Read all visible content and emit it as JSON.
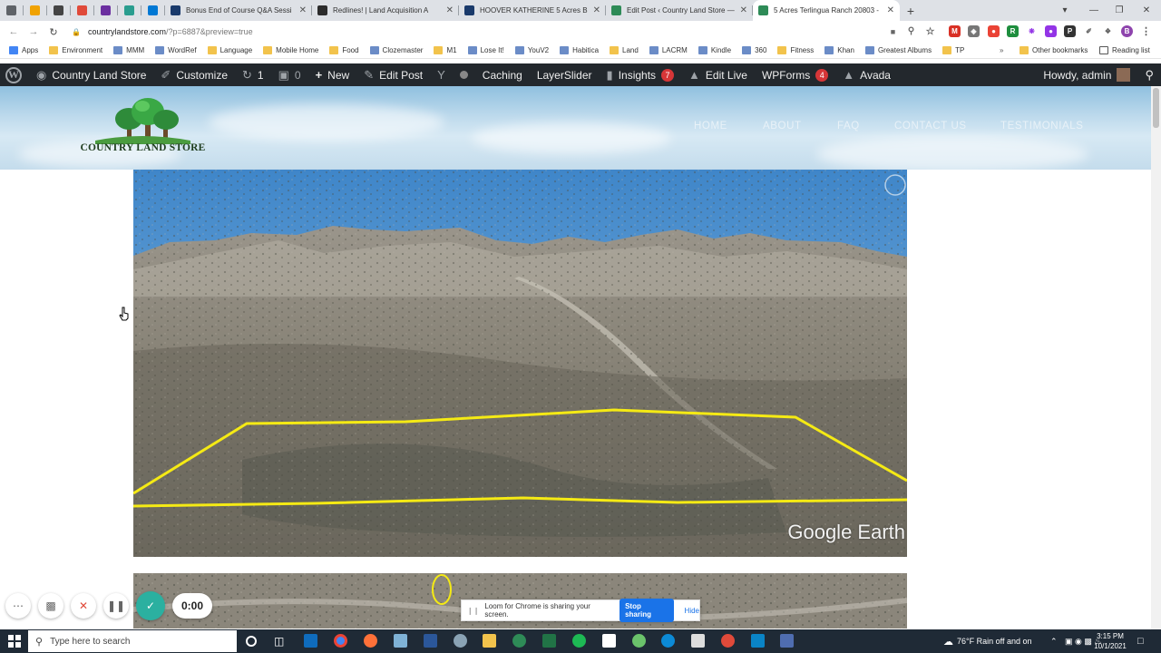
{
  "browser": {
    "tabs": [
      {
        "title": "",
        "color": "#5f6368"
      },
      {
        "title": "",
        "color": "#f0a202"
      },
      {
        "title": "",
        "color": "#444444"
      },
      {
        "title": "",
        "color": "#e04a3a"
      },
      {
        "title": "",
        "color": "#6b2fa0"
      },
      {
        "title": "",
        "color": "#2a9d8f"
      },
      {
        "title": "",
        "color": "#0078d4"
      },
      {
        "title": "Bonus End of Course Q&A Sessi",
        "color": "#1a3a6b"
      },
      {
        "title": "Redlines! | Land Acquisition A",
        "color": "#2c2c2c"
      },
      {
        "title": "HOOVER KATHERINE 5 Acres Bre",
        "color": "#1a3a6b"
      },
      {
        "title": "Edit Post ‹ Country Land Store —",
        "color": "#2e8b57"
      },
      {
        "title": "5 Acres Terlingua Ranch 20803 -",
        "color": "#2e8b57"
      }
    ],
    "new_tab": "+",
    "url_host": "countrylandstore.com",
    "url_path": "/?p=6887&preview=true",
    "profile_initial": "B"
  },
  "bookmarks": [
    {
      "label": "Apps",
      "kind": "apps"
    },
    {
      "label": "Environment",
      "kind": "folder"
    },
    {
      "label": "MMM",
      "kind": "site"
    },
    {
      "label": "WordRef",
      "kind": "site"
    },
    {
      "label": "Language",
      "kind": "folder"
    },
    {
      "label": "Mobile Home",
      "kind": "folder"
    },
    {
      "label": "Food",
      "kind": "folder"
    },
    {
      "label": "Clozemaster",
      "kind": "site"
    },
    {
      "label": "M1",
      "kind": "folder"
    },
    {
      "label": "Lose It!",
      "kind": "site"
    },
    {
      "label": "YouV2",
      "kind": "site"
    },
    {
      "label": "Habitica",
      "kind": "site"
    },
    {
      "label": "Land",
      "kind": "folder"
    },
    {
      "label": "LACRM",
      "kind": "site"
    },
    {
      "label": "Kindle",
      "kind": "site"
    },
    {
      "label": "360",
      "kind": "site"
    },
    {
      "label": "Fitness",
      "kind": "folder"
    },
    {
      "label": "Khan",
      "kind": "site"
    },
    {
      "label": "Greatest Albums",
      "kind": "site"
    },
    {
      "label": "TP",
      "kind": "folder"
    }
  ],
  "bookmarks_more": "»",
  "other_bookmarks": "Other bookmarks",
  "reading_list": "Reading list",
  "admin_bar": {
    "site_name": "Country Land Store",
    "customize": "Customize",
    "updates_count": "1",
    "comments_count": "0",
    "new": "New",
    "edit_post": "Edit Post",
    "caching": "Caching",
    "layerslider": "LayerSlider",
    "insights": "Insights",
    "insights_badge": "7",
    "edit_live": "Edit Live",
    "wpforms": "WPForms",
    "wpforms_badge": "4",
    "avada": "Avada",
    "howdy": "Howdy, admin"
  },
  "site": {
    "logo_text": "COUNTRY LAND STORE",
    "nav": [
      "HOME",
      "ABOUT",
      "FAQ",
      "CONTACT US",
      "TESTIMONIALS"
    ]
  },
  "hero": {
    "watermark": "Google Earth",
    "boundary_color": "#f5ea14"
  },
  "loom": {
    "timer": "0:00",
    "sharing_text": "Loom for Chrome is sharing your screen.",
    "stop_sharing": "Stop sharing",
    "hide": "Hide"
  },
  "taskbar": {
    "search_placeholder": "Type here to search",
    "weather": "76°F  Rain off and on",
    "time": "3:15 PM",
    "date": "10/1/2021"
  }
}
